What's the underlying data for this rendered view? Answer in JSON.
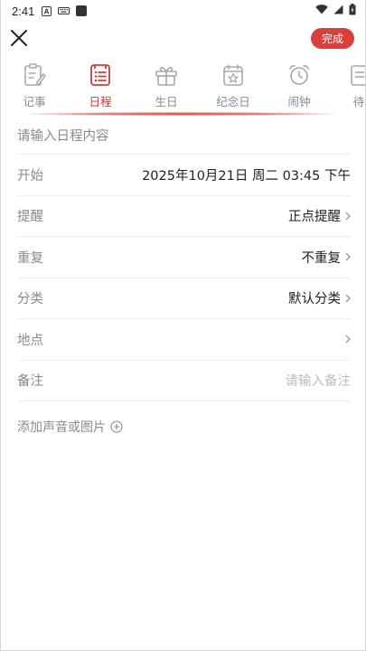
{
  "status_bar": {
    "time": "2:41"
  },
  "header": {
    "done_label": "完成"
  },
  "tabs": [
    {
      "label": "记事",
      "icon": "note-icon",
      "active": false
    },
    {
      "label": "日程",
      "icon": "schedule-list-icon",
      "active": true
    },
    {
      "label": "生日",
      "icon": "gift-icon",
      "active": false
    },
    {
      "label": "纪念日",
      "icon": "calendar-star-icon",
      "active": false
    },
    {
      "label": "闹钟",
      "icon": "alarm-clock-icon",
      "active": false
    },
    {
      "label": "待",
      "icon": "todo-icon",
      "active": false
    }
  ],
  "form": {
    "content_placeholder": "请输入日程内容",
    "start_label": "开始",
    "start_value": "2025年10月21日 周二 03:45 下午",
    "reminder_label": "提醒",
    "reminder_value": "正点提醒",
    "repeat_label": "重复",
    "repeat_value": "不重复",
    "category_label": "分类",
    "category_value": "默认分类",
    "location_label": "地点",
    "note_label": "备注",
    "note_placeholder": "请输入备注",
    "add_media_label": "添加声音或图片"
  },
  "colors": {
    "accent": "#d8403c",
    "active_tab": "#d03b35",
    "muted_text": "#8a8a8a",
    "placeholder": "#bdbdbd"
  }
}
